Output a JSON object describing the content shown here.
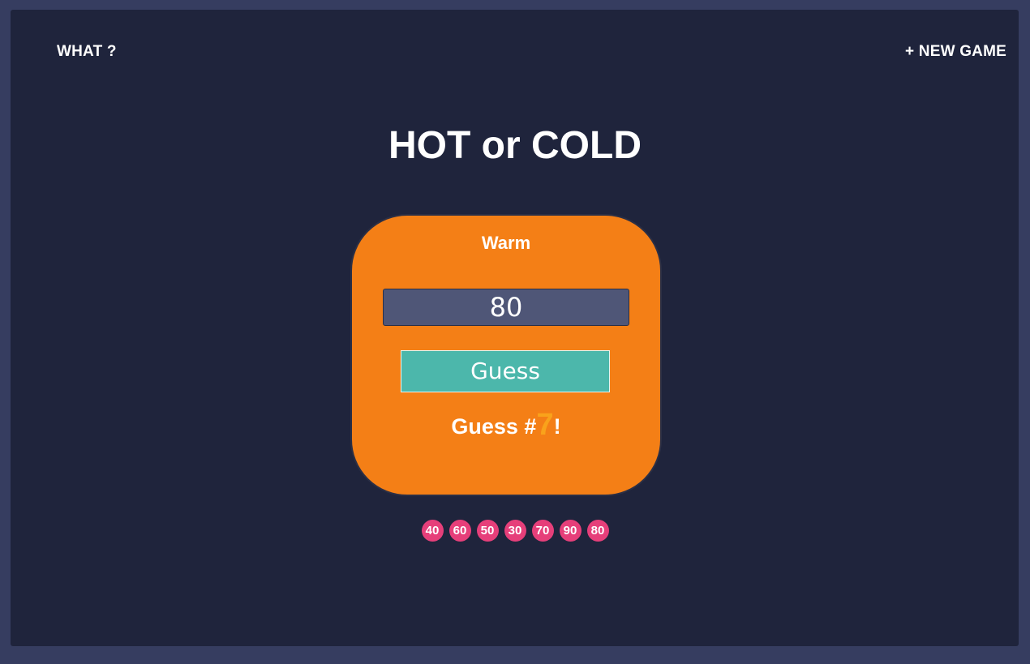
{
  "nav": {
    "what_label": "WHAT ?",
    "new_game_label": "+ NEW GAME"
  },
  "title": "HOT or COLD",
  "game": {
    "feedback": "Warm",
    "input_value": "80",
    "guess_button_label": "Guess",
    "count_prefix": "Guess #",
    "count": "7",
    "count_suffix": "!"
  },
  "history": [
    "40",
    "60",
    "50",
    "30",
    "70",
    "90",
    "80"
  ],
  "colors": {
    "background": "#1f243c",
    "card": "#f47f16",
    "button": "#4cb7ab",
    "chip": "#e63f7a",
    "count": "#f9a21b"
  }
}
